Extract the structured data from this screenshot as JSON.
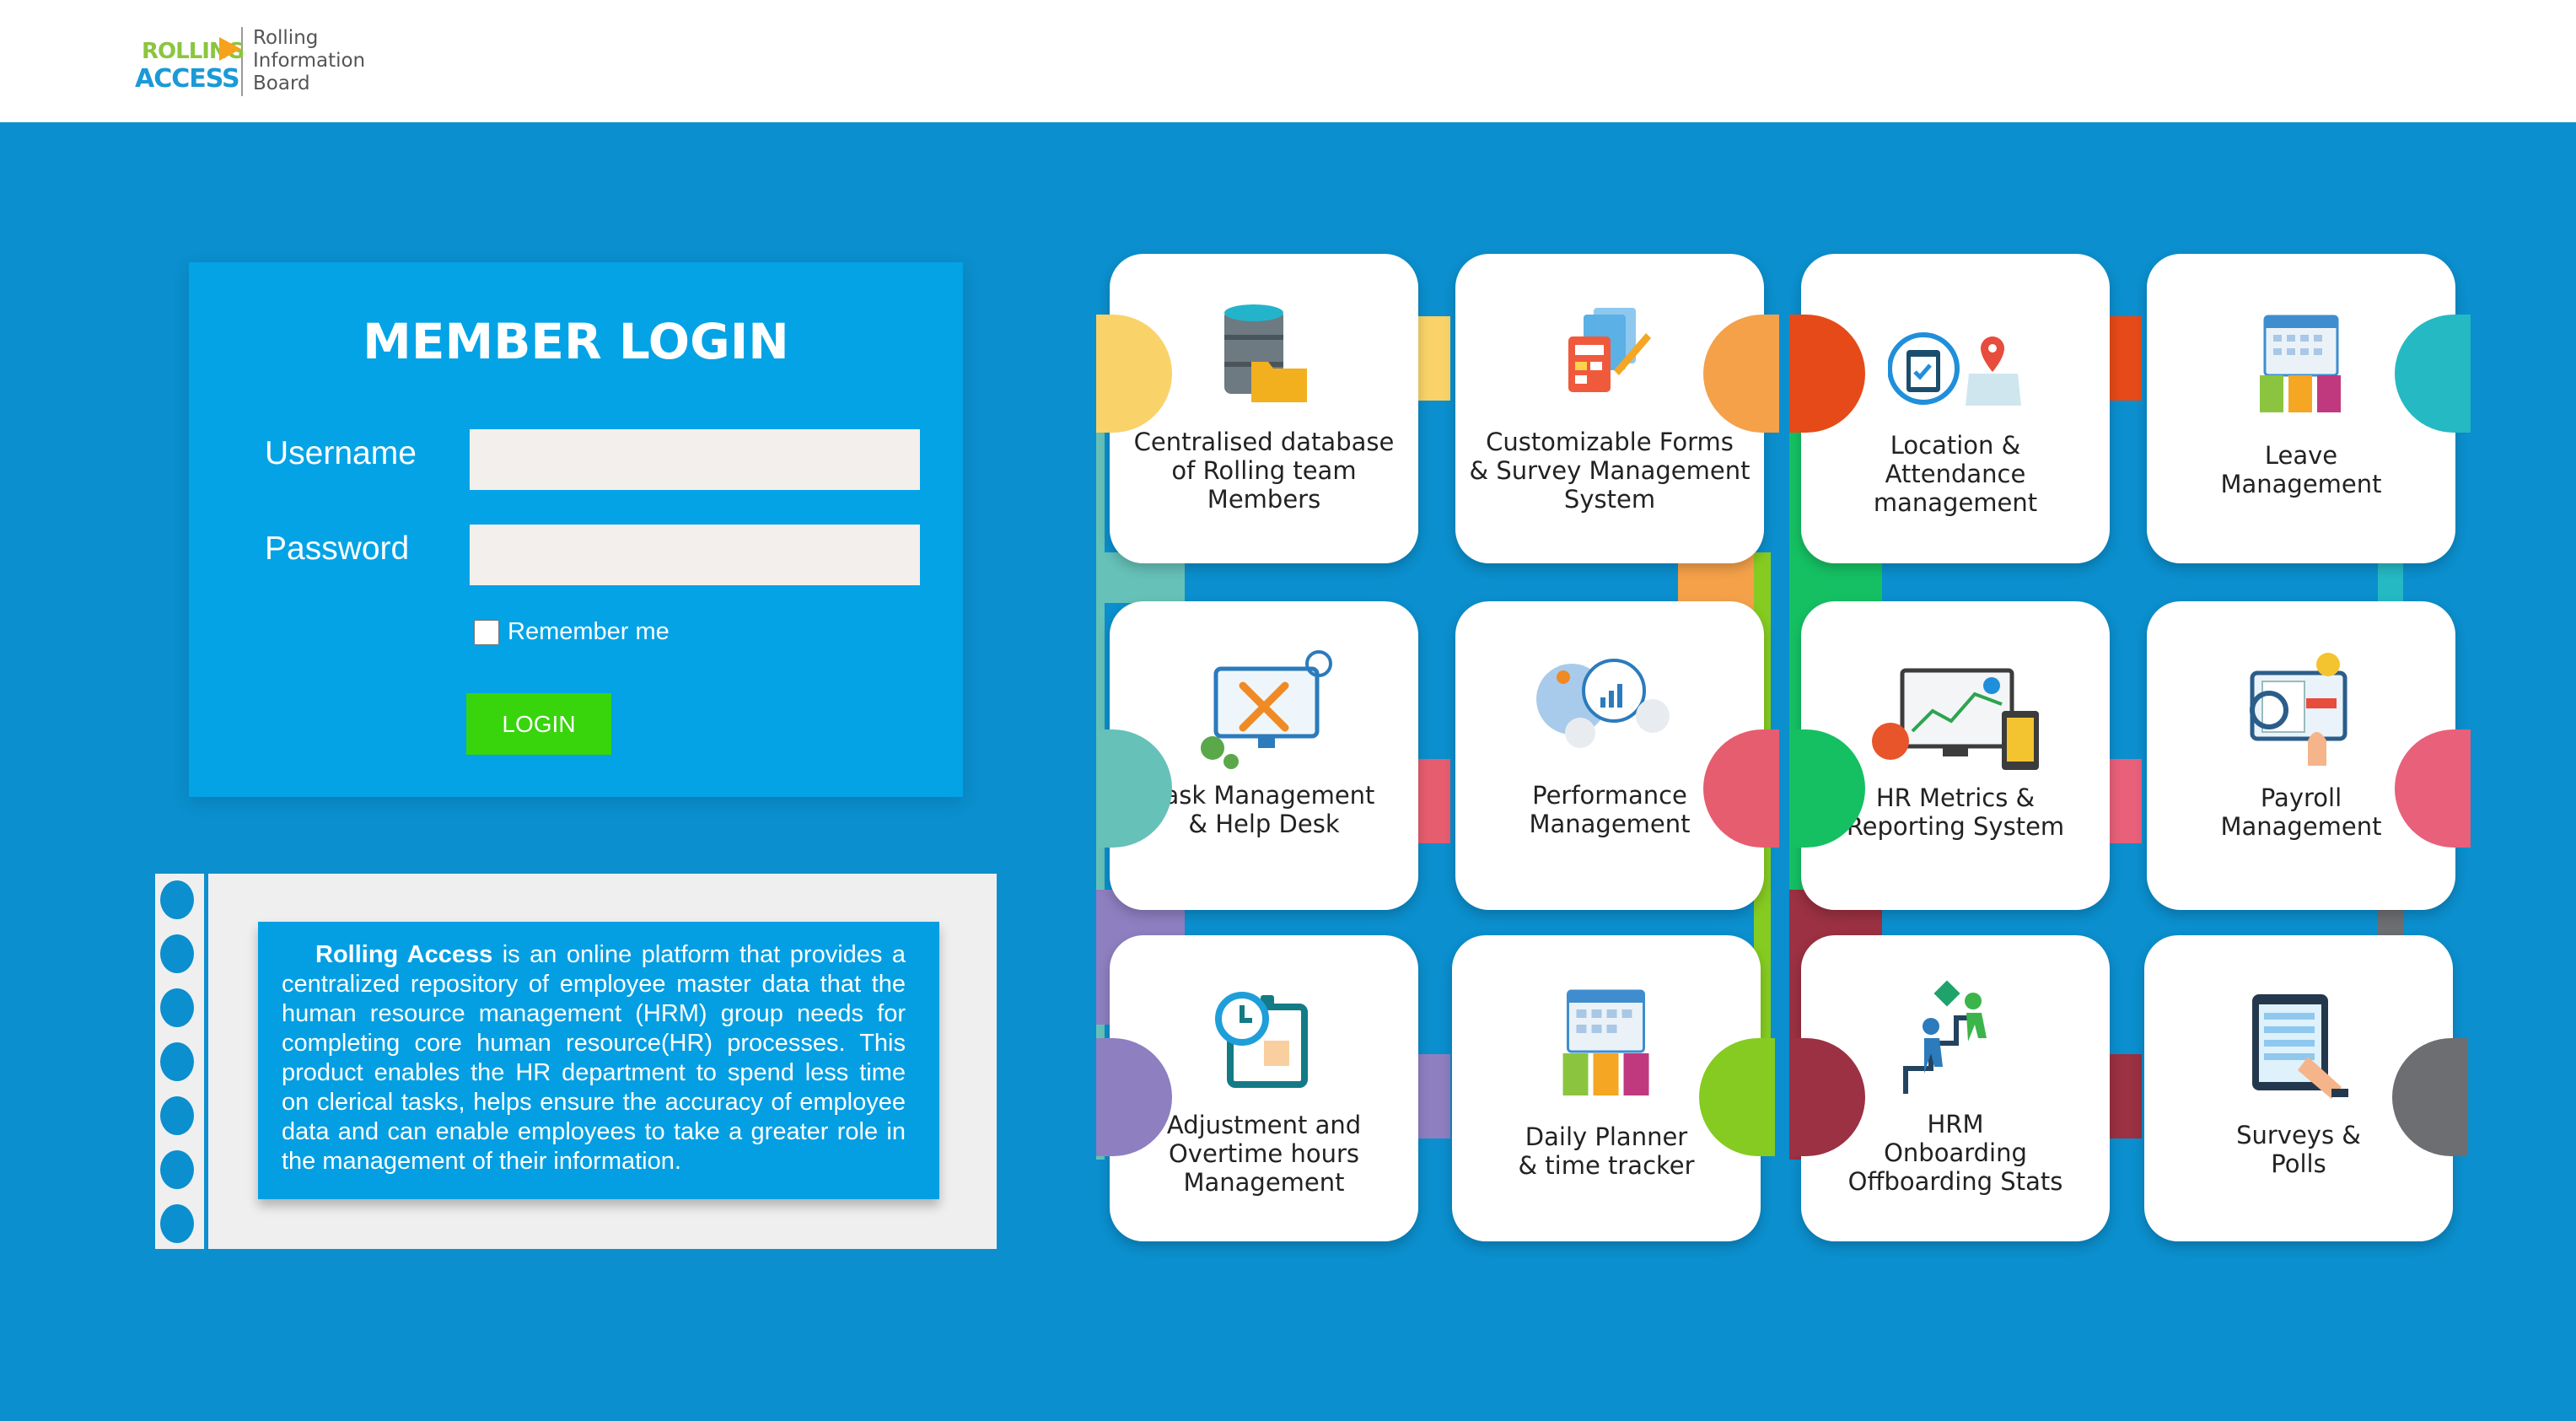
{
  "header": {
    "logo": {
      "word1": "ROLLING",
      "word2": "ACCESS",
      "tagline_line1": "Rolling",
      "tagline_line2": "Information",
      "tagline_line3": "Board"
    }
  },
  "login": {
    "title": "MEMBER LOGIN",
    "username_label": "Username",
    "username_value": "",
    "password_label": "Password",
    "password_value": "",
    "remember_label": "Remember me",
    "remember_checked": false,
    "button_label": "LOGIN"
  },
  "about": {
    "brand": "Rolling Access",
    "text": " is an online platform that provides a centralized repository of employee master data that the human resource management (HRM) group needs for completing core human resource(HR) processes. This product enables the HR department to spend less time on clerical tasks, helps ensure the accuracy of employee data and can enable employees to take a greater role in the management of their information."
  },
  "features": [
    {
      "label_lines": [
        "Centralised database",
        "of Rolling team",
        "Members"
      ],
      "icon": "database-icon",
      "accent": "#f9d36a"
    },
    {
      "label_lines": [
        "Customizable Forms",
        "& Survey Management",
        "System"
      ],
      "icon": "forms-icon",
      "accent": "#f4a14a"
    },
    {
      "label_lines": [
        "Location &",
        "Attendance",
        "management"
      ],
      "icon": "location-icon",
      "accent": "#e64a18"
    },
    {
      "label_lines": [
        "Leave",
        "Management"
      ],
      "icon": "calendar-icon",
      "accent": "#25b9c4"
    },
    {
      "label_lines": [
        "Task Management",
        "& Help Desk"
      ],
      "icon": "task-icon",
      "accent": "#66c1b8"
    },
    {
      "label_lines": [
        "Performance",
        "Management"
      ],
      "icon": "performance-icon",
      "accent": "#e65d6f"
    },
    {
      "label_lines": [
        "HR Metrics &",
        "Reporting System"
      ],
      "icon": "metrics-icon",
      "accent": "#15c063"
    },
    {
      "label_lines": [
        "Payroll",
        "Management"
      ],
      "icon": "payroll-icon",
      "accent": "#e8607a"
    },
    {
      "label_lines": [
        "Adjustment and",
        "Overtime hours",
        "Management"
      ],
      "icon": "clock-icon",
      "accent": "#8e7fc1"
    },
    {
      "label_lines": [
        "Daily Planner",
        "& time tracker"
      ],
      "icon": "planner-icon",
      "accent": "#86cb21"
    },
    {
      "label_lines": [
        "HRM",
        "Onboarding",
        "Offboarding Stats"
      ],
      "icon": "onboarding-icon",
      "accent": "#9b3142"
    },
    {
      "label_lines": [
        "Surveys &",
        "Polls"
      ],
      "icon": "survey-tablet-icon",
      "accent": "#6d6e71"
    }
  ]
}
